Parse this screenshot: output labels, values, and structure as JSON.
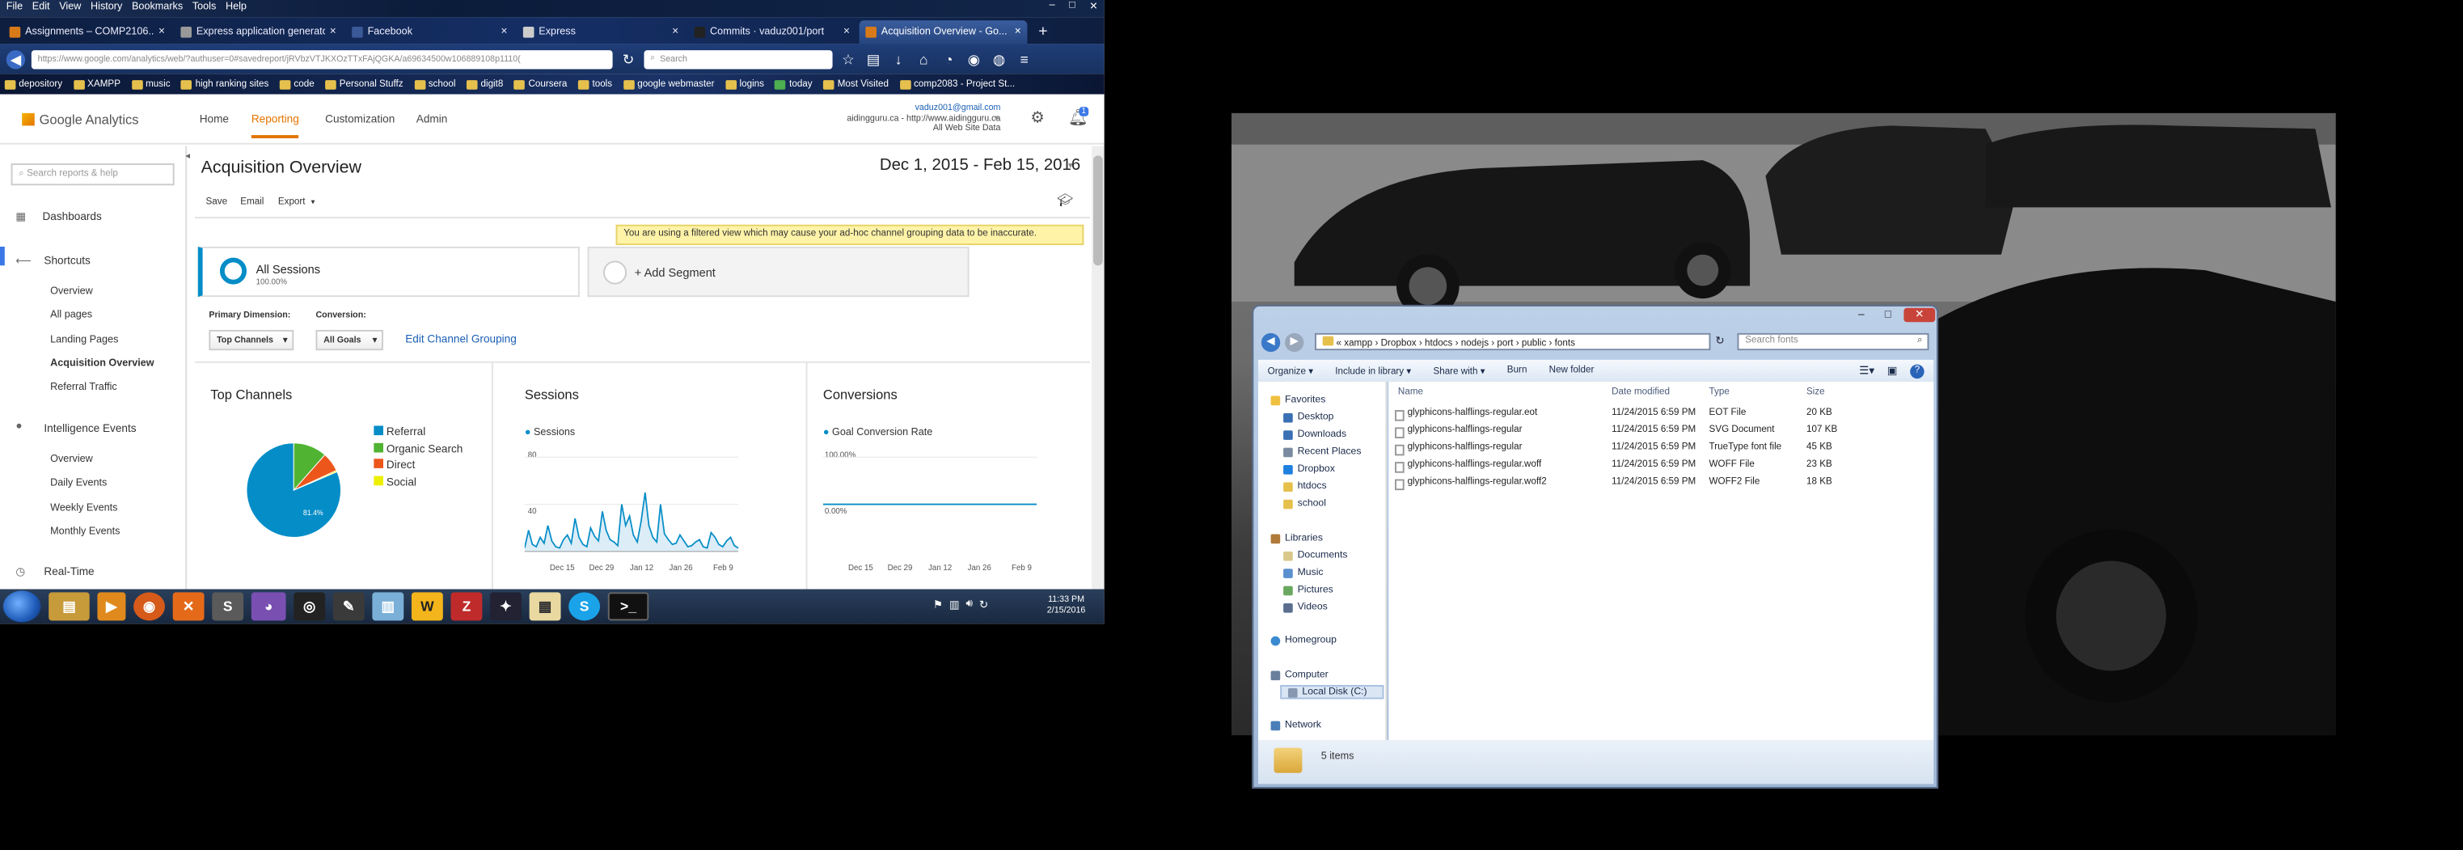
{
  "firefox": {
    "menu": [
      "File",
      "Edit",
      "View",
      "History",
      "Bookmarks",
      "Tools",
      "Help"
    ],
    "tabs": [
      {
        "title": "Assignments – COMP2106...",
        "active": false
      },
      {
        "title": "Express application generator",
        "active": false
      },
      {
        "title": "Facebook",
        "active": false
      },
      {
        "title": "Express",
        "active": false
      },
      {
        "title": "Commits · vaduz001/port",
        "active": false
      },
      {
        "title": "Acquisition Overview - Go...",
        "active": true
      }
    ],
    "url": "https://www.google.com/analytics/web/?authuser=0#savedreport/jRVbzVTJKXOzTTxFAjQGKA/a69634500w106889108p1110(",
    "search_placeholder": "Search",
    "bookmarks": [
      "depository",
      "XAMPP",
      "music",
      "high ranking sites",
      "code",
      "Personal Stuffz",
      "school",
      "digit8",
      "Coursera",
      "tools",
      "google webmaster",
      "logins",
      "today",
      "Most Visited",
      "comp2083 - Project St..."
    ]
  },
  "ga": {
    "logo": "Google Analytics",
    "nav": [
      "Home",
      "Reporting",
      "Customization",
      "Admin"
    ],
    "account": {
      "email": "vaduz001@gmail.com",
      "site": "aidingguru.ca - http://www.aidingguru.ca",
      "view": "All Web Site Data"
    },
    "notification_count": "1",
    "sidebar": {
      "search_placeholder": "Search reports & help",
      "dashboards": "Dashboards",
      "shortcuts": "Shortcuts",
      "shortcut_items": [
        "Overview",
        "All pages",
        "Landing Pages",
        "Acquisition Overview",
        "Referral Traffic"
      ],
      "intelligence": "Intelligence Events",
      "intel_items": [
        "Overview",
        "Daily Events",
        "Weekly Events",
        "Monthly Events"
      ],
      "realtime": "Real-Time"
    },
    "report": {
      "title": "Acquisition Overview",
      "date_range": "Dec 1, 2015 - Feb 15, 2016",
      "actions": [
        "Save",
        "Email",
        "Export"
      ],
      "warning": "You are using a filtered view which may cause your ad-hoc channel grouping data to be inaccurate.",
      "segment_name": "All Sessions",
      "segment_pct": "100.00%",
      "add_segment": "+ Add Segment",
      "primary_dimension_label": "Primary Dimension:",
      "conversion_label": "Conversion:",
      "dim_value": "Top Channels",
      "conv_value": "All Goals",
      "edit_channel": "Edit Channel Grouping"
    },
    "top_channels": {
      "title": "Top Channels",
      "legend": [
        {
          "name": "Referral",
          "color": "#058dc7"
        },
        {
          "name": "Organic Search",
          "color": "#50b432"
        },
        {
          "name": "Direct",
          "color": "#ed561b"
        },
        {
          "name": "Social",
          "color": "#edef00"
        }
      ],
      "slice_label": "81.4%"
    },
    "sessions": {
      "title": "Sessions",
      "legend": "Sessions",
      "yticks": [
        "80",
        "40"
      ],
      "xticks": [
        "Dec 15",
        "Dec 29",
        "Jan 12",
        "Jan 26",
        "Feb 9"
      ]
    },
    "conversions": {
      "title": "Conversions",
      "legend": "Goal Conversion Rate",
      "yticks": [
        "100.00%",
        "0.00%"
      ],
      "xticks": [
        "Dec 15",
        "Dec 29",
        "Jan 12",
        "Jan 26",
        "Feb 9"
      ]
    }
  },
  "chart_data": [
    {
      "type": "pie",
      "title": "Top Channels",
      "categories": [
        "Referral",
        "Organic Search",
        "Direct",
        "Social"
      ],
      "values": [
        81.4,
        11.5,
        6.6,
        0.5
      ]
    },
    {
      "type": "area",
      "title": "Sessions",
      "series": [
        {
          "name": "Sessions",
          "values": [
            3,
            18,
            6,
            4,
            12,
            7,
            22,
            9,
            4,
            3,
            10,
            14,
            7,
            28,
            12,
            6,
            4,
            20,
            13,
            9,
            34,
            18,
            10,
            8,
            5,
            40,
            22,
            30,
            14,
            8,
            26,
            50,
            22,
            12,
            8,
            40,
            15,
            10,
            6,
            7,
            14,
            9,
            4,
            5,
            8,
            10,
            4,
            3,
            16,
            12,
            6,
            4,
            9,
            12,
            5,
            3
          ]
        }
      ],
      "ylim": [
        0,
        80
      ]
    },
    {
      "type": "line",
      "title": "Conversions",
      "series": [
        {
          "name": "Goal Conversion Rate",
          "values": [
            0,
            0,
            0,
            0,
            0,
            0,
            0,
            0,
            0,
            0
          ]
        }
      ],
      "ylim": [
        0,
        100
      ]
    }
  ],
  "taskbar": {
    "apps": [
      "Windows Explorer",
      "Media Player",
      "Firefox",
      "XAMPP",
      "Sublime Text",
      "GitHub",
      "Steam",
      "Krita",
      "Notepad",
      "WebStorm",
      "FileZilla",
      "Flux",
      "Files",
      "Skype",
      "Console"
    ],
    "time": "11:33 PM",
    "date": "2/15/2016"
  },
  "explorer": {
    "path": "« xampp › Dropbox › htdocs › nodejs › port › public › fonts",
    "search_placeholder": "Search fonts",
    "toolbar": [
      "Organize ▾",
      "Include in library ▾",
      "Share with ▾",
      "Burn",
      "New folder"
    ],
    "nav_favorites": "Favorites",
    "favorites": [
      "Desktop",
      "Downloads",
      "Recent Places",
      "Dropbox",
      "htdocs",
      "school"
    ],
    "nav_libraries": "Libraries",
    "libraries": [
      "Documents",
      "Music",
      "Pictures",
      "Videos"
    ],
    "homegroup": "Homegroup",
    "computer": "Computer",
    "local_disk": "Local Disk (C:)",
    "network": "Network",
    "columns": [
      "Name",
      "Date modified",
      "Type",
      "Size"
    ],
    "files": [
      {
        "name": "glyphicons-halflings-regular.eot",
        "date": "11/24/2015 6:59 PM",
        "type": "EOT File",
        "size": "20 KB"
      },
      {
        "name": "glyphicons-halflings-regular",
        "date": "11/24/2015 6:59 PM",
        "type": "SVG Document",
        "size": "107 KB"
      },
      {
        "name": "glyphicons-halflings-regular",
        "date": "11/24/2015 6:59 PM",
        "type": "TrueType font file",
        "size": "45 KB"
      },
      {
        "name": "glyphicons-halflings-regular.woff",
        "date": "11/24/2015 6:59 PM",
        "type": "WOFF File",
        "size": "23 KB"
      },
      {
        "name": "glyphicons-halflings-regular.woff2",
        "date": "11/24/2015 6:59 PM",
        "type": "WOFF2 File",
        "size": "18 KB"
      }
    ],
    "status": "5 items"
  }
}
